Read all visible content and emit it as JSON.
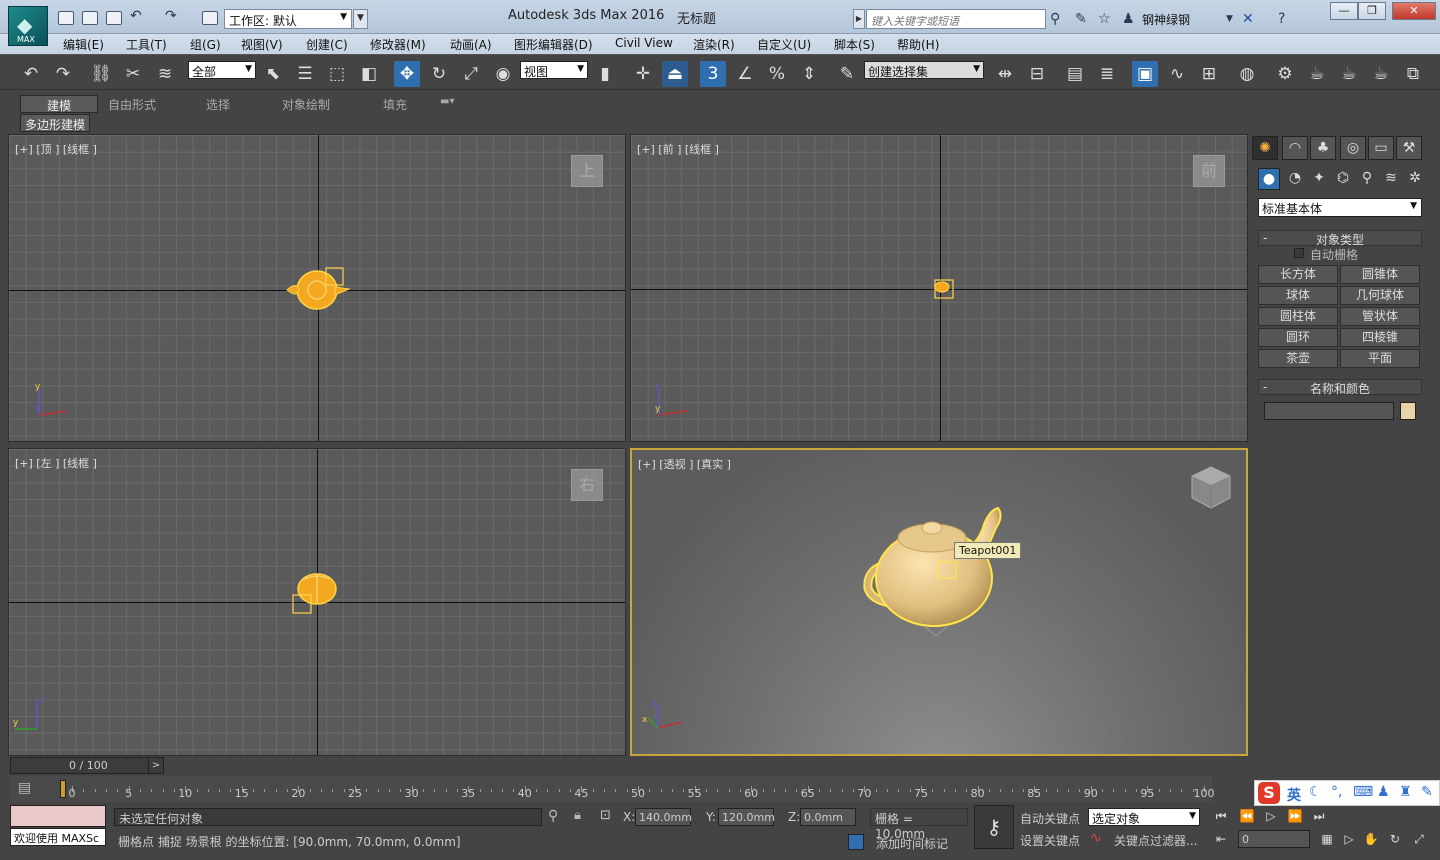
{
  "app": {
    "logo_text": "MAX",
    "title": "Autodesk 3ds Max 2016",
    "document": "无标题",
    "workspace": "工作区: 默认",
    "search_placeholder": "键入关键字或短语",
    "user": "钢神绿钢"
  },
  "menu": [
    "编辑(E)",
    "工具(T)",
    "组(G)",
    "视图(V)",
    "创建(C)",
    "修改器(M)",
    "动画(A)",
    "图形编辑器(D)",
    "Civil View",
    "渲染(R)",
    "自定义(U)",
    "脚本(S)",
    "帮助(H)"
  ],
  "toolbar": {
    "selection_filter": "全部",
    "reference_coord": "视图",
    "snap_toggle": "3",
    "named_selection": "创建选择集"
  },
  "ribbon": {
    "tabs": [
      "建模",
      "自由形式",
      "选择",
      "对象绘制",
      "填充"
    ],
    "sub_tab": "多边形建模"
  },
  "viewports": {
    "top": {
      "label": "[+] [顶 ] [线框 ]",
      "cube": "上"
    },
    "front": {
      "label": "[+] [前 ] [线框 ]",
      "cube": "前"
    },
    "left": {
      "label": "[+] [左 ] [线框 ]",
      "cube": "右"
    },
    "perspective": {
      "label": "[+] [透视 ] [真实 ]",
      "object_tooltip": "Teapot001"
    }
  },
  "command_panel": {
    "category": "标准基本体",
    "rollout_object_type": "对象类型",
    "auto_grid": "自动栅格",
    "primitives": [
      "长方体",
      "圆锥体",
      "球体",
      "几何球体",
      "圆柱体",
      "管状体",
      "圆环",
      "四棱锥",
      "茶壶",
      "平面"
    ],
    "rollout_name_color": "名称和颜色",
    "object_color": "#e8d2a8"
  },
  "timeline": {
    "frame": "0 / 100",
    "ticks": [
      "0",
      "5",
      "10",
      "15",
      "20",
      "25",
      "30",
      "35",
      "40",
      "45",
      "50",
      "55",
      "60",
      "65",
      "70",
      "75",
      "80",
      "85",
      "90",
      "95",
      "100"
    ]
  },
  "status": {
    "welcome": "欢迎使用 MAXSc",
    "selection": "未选定任何对象",
    "prompt": "栅格点 捕捉 场景根 的坐标位置: [90.0mm, 70.0mm, 0.0mm]",
    "x_label": "X:",
    "x": "140.0mm",
    "y_label": "Y:",
    "y": "120.0mm",
    "z_label": "Z:",
    "z": "0.0mm",
    "grid": "栅格 = 10.0mm",
    "add_time_tag": "添加时间标记",
    "auto_key": "自动关键点",
    "set_key": "设置关键点",
    "key_mode": "选定对象",
    "key_filters": "关键点过滤器...",
    "frame_input": "0"
  },
  "ime": {
    "logo": "S",
    "lang": "英"
  }
}
